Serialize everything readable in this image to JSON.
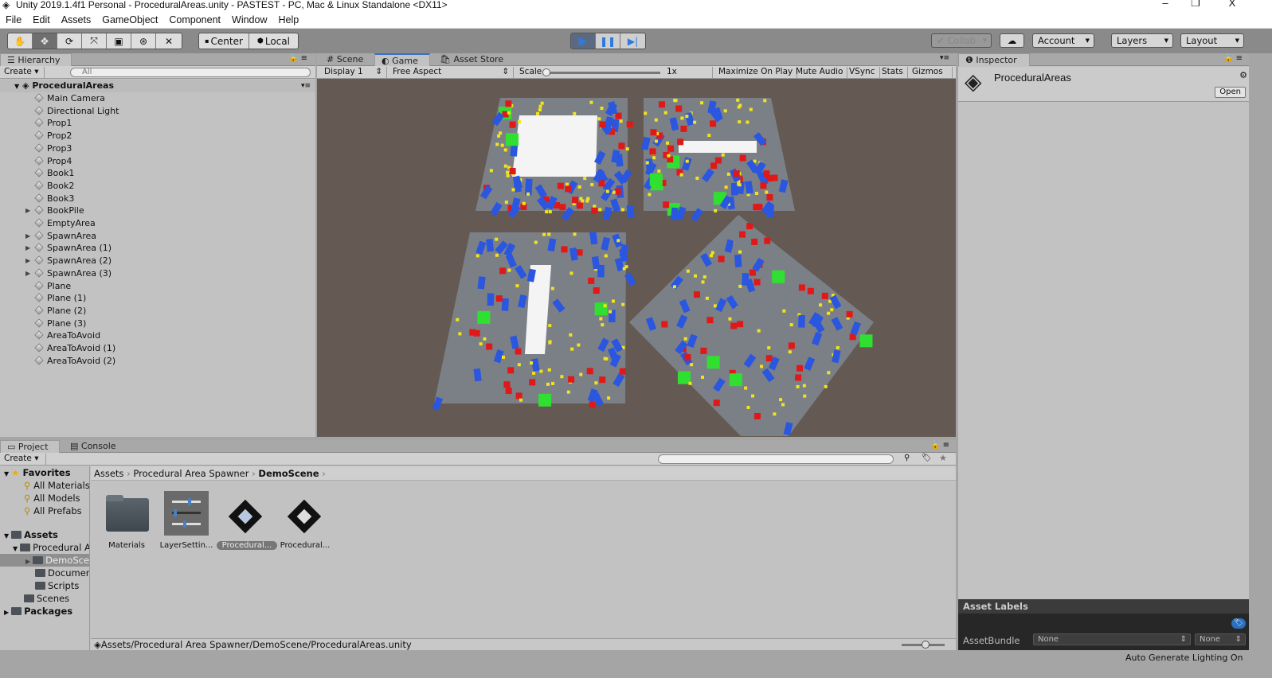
{
  "window": {
    "title": "Unity 2019.1.4f1 Personal - ProceduralAreas.unity - PASTEST - PC, Mac & Linux Standalone <DX11>",
    "minimize": "–",
    "restore": "❐",
    "close": "X"
  },
  "menu": [
    "File",
    "Edit",
    "Assets",
    "GameObject",
    "Component",
    "Window",
    "Help"
  ],
  "toolbar": {
    "tools": [
      "hand",
      "move",
      "rotate",
      "scale",
      "rect",
      "transform",
      "custom"
    ],
    "pivot": "Center",
    "space": "Local",
    "collab": "Collab",
    "account": "Account",
    "layers": "Layers",
    "layout": "Layout",
    "play_color": "#2c7be0"
  },
  "hierarchy": {
    "tab": "Hierarchy",
    "create": "Create",
    "search_placeholder": "All",
    "scene": "ProceduralAreas",
    "items": [
      {
        "label": "Main Camera"
      },
      {
        "label": "Directional Light"
      },
      {
        "label": "Prop1"
      },
      {
        "label": "Prop2"
      },
      {
        "label": "Prop3"
      },
      {
        "label": "Prop4"
      },
      {
        "label": "Book1"
      },
      {
        "label": "Book2"
      },
      {
        "label": "Book3"
      },
      {
        "label": "BookPile",
        "expandable": true
      },
      {
        "label": "EmptyArea"
      },
      {
        "label": "SpawnArea",
        "expandable": true
      },
      {
        "label": "SpawnArea (1)",
        "expandable": true
      },
      {
        "label": "SpawnArea (2)",
        "expandable": true
      },
      {
        "label": "SpawnArea (3)",
        "expandable": true
      },
      {
        "label": "Plane"
      },
      {
        "label": "Plane (1)"
      },
      {
        "label": "Plane (2)"
      },
      {
        "label": "Plane (3)"
      },
      {
        "label": "AreaToAvoid"
      },
      {
        "label": "AreaToAvoid (1)"
      },
      {
        "label": "AreaToAvoid (2)"
      }
    ]
  },
  "center_tabs": {
    "scene": "Scene",
    "game": "Game",
    "store": "Asset Store"
  },
  "game_toolbar": {
    "display": "Display 1",
    "aspect": "Free Aspect",
    "scale_label": "Scale",
    "scale_value": "1x",
    "maximize": "Maximize On Play",
    "mute": "Mute Audio",
    "vsync": "VSync",
    "stats": "Stats",
    "gizmos": "Gizmos"
  },
  "inspector": {
    "tab": "Inspector",
    "object": "ProceduralAreas",
    "open": "Open",
    "asset_labels": "Asset Labels",
    "assetbundle_label": "AssetBundle",
    "bundle1": "None",
    "bundle2": "None"
  },
  "project": {
    "tab": "Project",
    "console_tab": "Console",
    "create": "Create",
    "tree": {
      "favorites": "Favorites",
      "fav_items": [
        "All Materials",
        "All Models",
        "All Prefabs"
      ],
      "assets": "Assets",
      "procedural": "Procedural Area Spawner",
      "demoscene": "DemoScene",
      "documentation": "Documentation",
      "scripts": "Scripts",
      "scenes": "Scenes",
      "packages": "Packages"
    },
    "breadcrumb": [
      "Assets",
      "Procedural Area Spawner",
      "DemoScene"
    ],
    "items": [
      {
        "label": "Materials",
        "type": "folder"
      },
      {
        "label": "LayerSettin...",
        "type": "settings"
      },
      {
        "label": "Procedural...",
        "type": "unity-scene",
        "selected": true
      },
      {
        "label": "Procedural...",
        "type": "unity-scene"
      }
    ],
    "footer_path": "Assets/Procedural Area Spawner/DemoScene/ProceduralAreas.unity"
  },
  "status": {
    "text": "Auto Generate Lighting On"
  }
}
